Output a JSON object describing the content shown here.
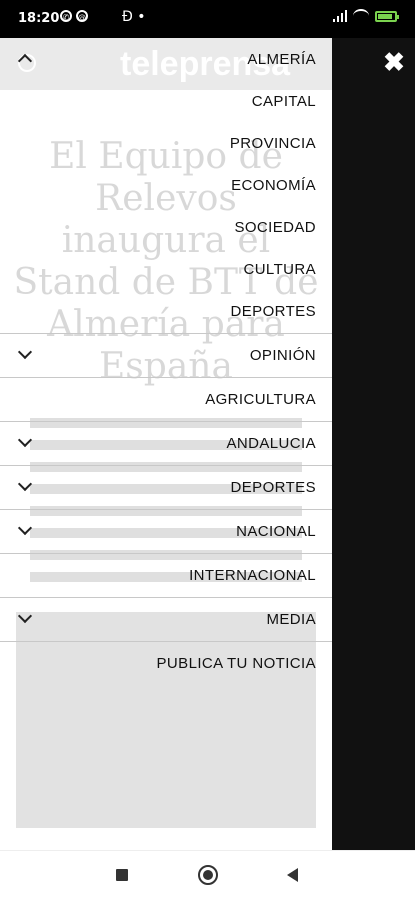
{
  "status": {
    "time": "18:20",
    "notification_icons": [
      "whatsapp-icon",
      "at-icon",
      "d-app-icon"
    ],
    "right_icons": [
      "signal-icon",
      "wifi-icon",
      "battery-icon"
    ]
  },
  "menu": {
    "items": [
      {
        "label": "ALMERÍA",
        "chevron": "up"
      },
      {
        "label": "CAPITAL",
        "chevron": ""
      },
      {
        "label": "PROVINCIA",
        "chevron": ""
      },
      {
        "label": "ECONOMÍA",
        "chevron": ""
      },
      {
        "label": "SOCIEDAD",
        "chevron": ""
      },
      {
        "label": "CULTURA",
        "chevron": ""
      },
      {
        "label": "DEPORTES",
        "chevron": ""
      },
      {
        "label": "OPINIÓN",
        "chevron": "down"
      },
      {
        "label": "AGRICULTURA",
        "chevron": ""
      },
      {
        "label": "ANDALUCIA",
        "chevron": "down"
      },
      {
        "label": "DEPORTES",
        "chevron": "down"
      },
      {
        "label": "NACIONAL",
        "chevron": "down"
      },
      {
        "label": "INTERNACIONAL",
        "chevron": ""
      },
      {
        "label": "MEDIA",
        "chevron": "down"
      },
      {
        "label": "PUBLICA TU NOTICIA",
        "chevron": ""
      }
    ]
  },
  "background": {
    "logo": "teleprensa",
    "headline": "El Equipo de Relevos inaugura el Stand de BTT de Almería para España"
  },
  "close_icon": "close-icon",
  "navbar": [
    "recents-button",
    "home-button",
    "back-button"
  ]
}
